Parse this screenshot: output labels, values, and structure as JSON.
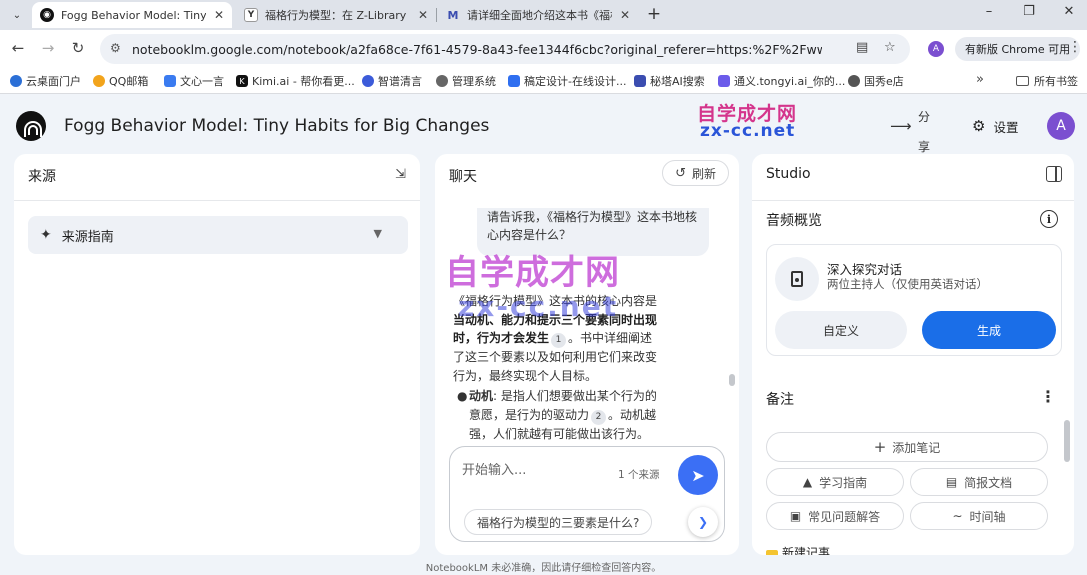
{
  "browser": {
    "tabs": [
      {
        "title": "Fogg Behavior Model: Tiny H",
        "active": true,
        "favicon": "notebooklm-icon"
      },
      {
        "title": "福格行为模型：在 Z-Library 上",
        "active": false,
        "favicon": "zlibrary-icon"
      },
      {
        "title": "请详细全面地介绍这本书《福格",
        "active": false,
        "favicon": "kimi-icon"
      }
    ],
    "url": "notebooklm.google.com/notebook/a2fa68ce-7f61-4579-8a43-fee1344f6cbc?original_referer=https:%2F%2Fwww.google.co...",
    "profile_initial": "A",
    "update_chip": "有新版 Chrome 可用",
    "bookmarks": [
      {
        "label": "云桌面门户",
        "color": "#2b6fd6"
      },
      {
        "label": "QQ邮箱",
        "color": "#f2a41c"
      },
      {
        "label": "文心一言",
        "color": "#3a7bf0"
      },
      {
        "label": "Kimi.ai - 帮你看更...",
        "color": "#111111"
      },
      {
        "label": "智谱清言",
        "color": "#3c5bd9"
      },
      {
        "label": "管理系统",
        "color": "#666666"
      },
      {
        "label": "稿定设计-在线设计...",
        "color": "#2f6ff0"
      },
      {
        "label": "秘塔AI搜索",
        "color": "#3b4db0"
      },
      {
        "label": "通义.tongyi.ai_你的...",
        "color": "#6b5bea"
      },
      {
        "label": "国秀e店",
        "color": "#555555"
      }
    ],
    "all_bookmarks": "所有书签"
  },
  "app": {
    "notebook_title": "Fogg Behavior Model: Tiny Habits for Big Changes",
    "share_label": "分享",
    "settings_label": "设置",
    "avatar_initial": "A"
  },
  "sources": {
    "title": "来源",
    "guide_label": "来源指南"
  },
  "chat": {
    "title": "聊天",
    "refresh_label": "刷新",
    "user_question": "请告诉我，《福格行为模型》这本书地核心内容是什么？",
    "answer_part1": "《福格行为模型》这本书的核心内容是",
    "answer_bold": "当动机、能力和提示三个要素同时出现时，行为才会发生",
    "answer_cite1": "1",
    "answer_part2": "。书中详细阐述了这三个要素以及如何利用它们来改变行为，最终实现个人目标。",
    "bullet_bold": "动机",
    "bullet_text1": ": 是指人们想要做出某个行为的意愿，是行为的驱动力",
    "bullet_cite": "2",
    "bullet_text2": "。动机越强，人们就越有可能做出该行为。",
    "input_placeholder": "开始输入...",
    "source_count": "1 个来源",
    "suggestion": "福格行为模型的三要素是什么?"
  },
  "studio": {
    "title": "Studio",
    "audio_title": "音频概览",
    "audio_card_title": "深入探究对话",
    "audio_card_sub": "两位主持人（仅使用英语对话）",
    "customize_label": "自定义",
    "generate_label": "生成",
    "notes_title": "备注",
    "add_note_label": "添加笔记",
    "chips": [
      "学习指南",
      "简报文档",
      "常见问题解答",
      "时间轴"
    ],
    "new_note_label": "新建记事"
  },
  "footer": "NotebookLM 未必准确，因此请仔细检查回答内容。",
  "watermark": {
    "top_line1": "自学成才网",
    "top_line2": "zx-cc.net",
    "mid_line1": "自学成才网",
    "mid_line2": "zx-cc.net"
  },
  "colors": {
    "accent": "#1a6ee8",
    "send": "#3b6ff5",
    "avatar": "#7b4fd0"
  }
}
